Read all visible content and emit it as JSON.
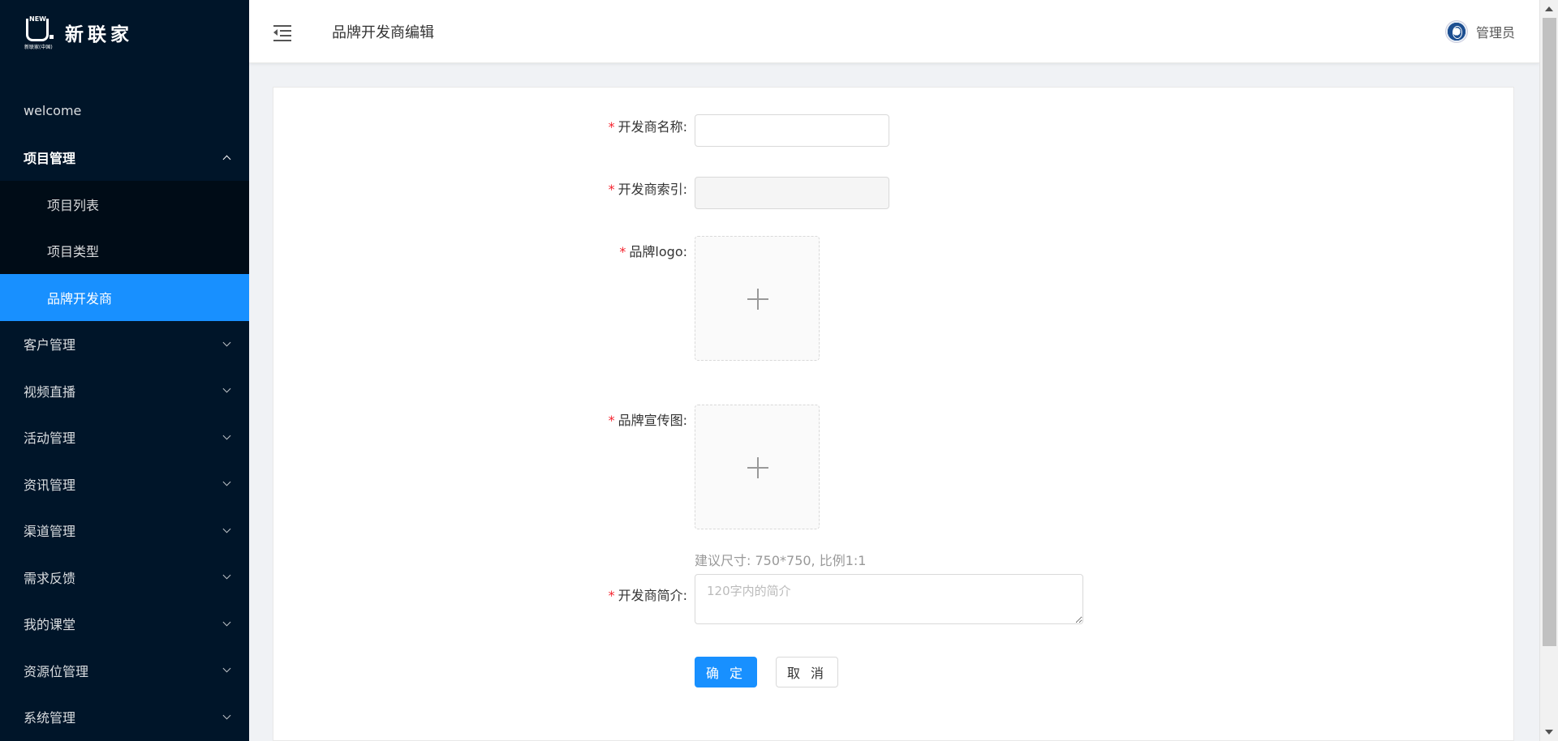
{
  "brand": {
    "logo_mark_text": "NEW",
    "logo_sub_text": "新联家(中国)",
    "name": "新联家"
  },
  "sidebar": {
    "items": [
      {
        "label": "welcome"
      },
      {
        "label": "项目管理",
        "expanded": true,
        "children": [
          {
            "label": "项目列表"
          },
          {
            "label": "项目类型"
          },
          {
            "label": "品牌开发商",
            "active": true
          }
        ]
      },
      {
        "label": "客户管理"
      },
      {
        "label": "视频直播"
      },
      {
        "label": "活动管理"
      },
      {
        "label": "资讯管理"
      },
      {
        "label": "渠道管理"
      },
      {
        "label": "需求反馈"
      },
      {
        "label": "我的课堂"
      },
      {
        "label": "资源位管理"
      },
      {
        "label": "系统管理"
      }
    ]
  },
  "header": {
    "title": "品牌开发商编辑",
    "user_name": "管理员"
  },
  "form": {
    "name_label": "开发商名称:",
    "name_value": "",
    "index_label": "开发商索引:",
    "index_value": "",
    "logo_label": "品牌logo:",
    "promo_label": "品牌宣传图:",
    "size_hint": "建议尺寸: 750*750, 比例1:1",
    "intro_label": "开发商简介:",
    "intro_placeholder": "120字内的简介",
    "required_mark": "*",
    "confirm_label": "确 定",
    "cancel_label": "取 消"
  },
  "colors": {
    "sidebar_bg": "#001529",
    "submenu_bg": "#000c17",
    "primary": "#1890ff",
    "required": "#f5222d"
  }
}
